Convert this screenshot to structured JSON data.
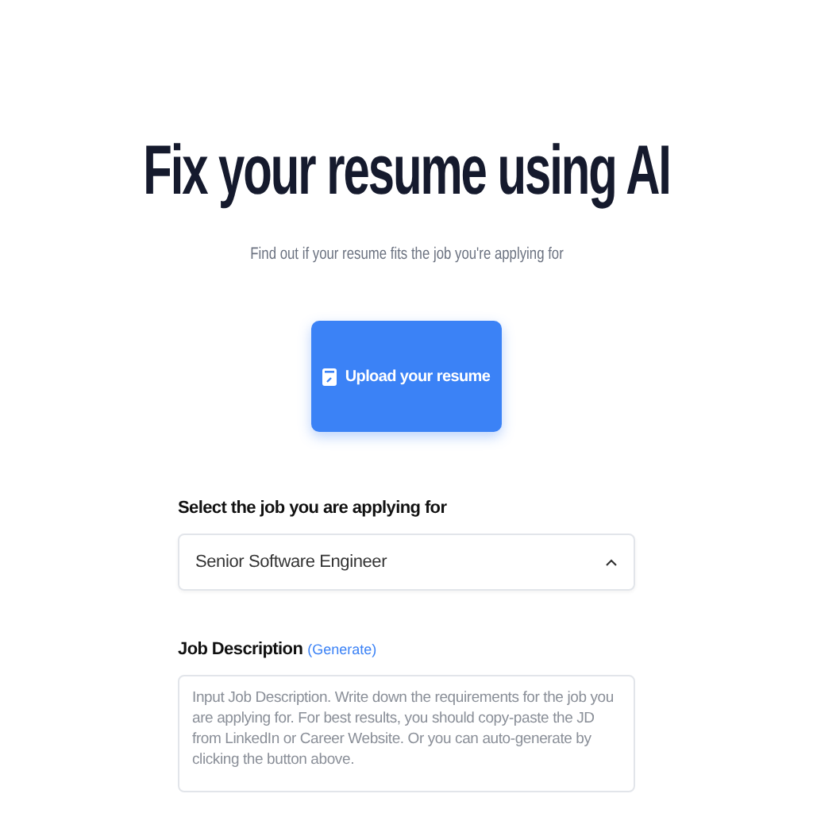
{
  "hero": {
    "title": "Fix your resume using AI",
    "subtitle": "Find out if your resume fits the job you're applying for"
  },
  "upload_button": {
    "label": "Upload your resume"
  },
  "job_select": {
    "label": "Select the job you are applying for",
    "value": "Senior Software Engineer",
    "expanded": true
  },
  "job_description": {
    "label": "Job Description",
    "generate_link": "(Generate)",
    "placeholder": "Input Job Description. Write down the requirements for the job you are applying for. For best results, you should copy-paste the JD from LinkedIn or Career Website. Or you can auto-generate by clicking the button above."
  }
}
